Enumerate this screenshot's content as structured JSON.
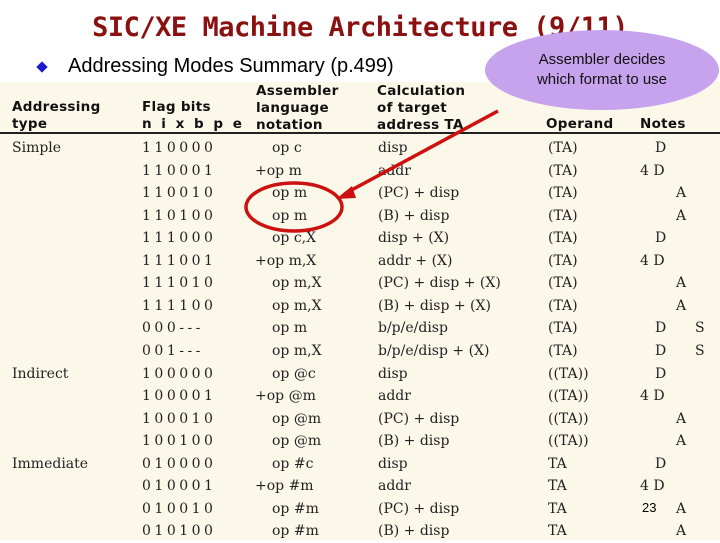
{
  "slide": {
    "title": "SIC/XE Machine Architecture (9/11)",
    "bullet": "Addressing Modes Summary (p.499)",
    "callout_line1": "Assembler decides",
    "callout_line2": "which format to use",
    "page_number": "23",
    "colors": {
      "title": "#8b1010",
      "bullet": "#1a1acc",
      "callout": "#c7a3ee",
      "annotation": "#cc1111"
    }
  },
  "table": {
    "headers": {
      "type": [
        "Addressing",
        "type"
      ],
      "flags": [
        "Flag bits",
        "n i x b p e"
      ],
      "notation": [
        "Assembler",
        "language",
        "notation"
      ],
      "calc": [
        "Calculation",
        "of target",
        "address TA"
      ],
      "operand": [
        "Operand"
      ],
      "notes": [
        "Notes"
      ]
    },
    "rows": [
      {
        "type": "Simple",
        "flags": "110000",
        "notation": "op c",
        "calc": "disp",
        "operand": "(TA)",
        "notes1": "D",
        "notes2": ""
      },
      {
        "type": "",
        "flags": "110001",
        "notation": "+op m",
        "calc": "addr",
        "operand": "(TA)",
        "notes1": "4 D",
        "notes2": ""
      },
      {
        "type": "",
        "flags": "110010",
        "notation": "op m",
        "calc": "(PC) + disp",
        "operand": "(TA)",
        "notes1": "A",
        "notes2": ""
      },
      {
        "type": "",
        "flags": "110100",
        "notation": "op m",
        "calc": "(B) + disp",
        "operand": "(TA)",
        "notes1": "A",
        "notes2": ""
      },
      {
        "type": "",
        "flags": "111000",
        "notation": "op c,X",
        "calc": "disp + (X)",
        "operand": "(TA)",
        "notes1": "D",
        "notes2": ""
      },
      {
        "type": "",
        "flags": "111001",
        "notation": "+op m,X",
        "calc": "addr + (X)",
        "operand": "(TA)",
        "notes1": "4 D",
        "notes2": ""
      },
      {
        "type": "",
        "flags": "111010",
        "notation": "op m,X",
        "calc": "(PC) + disp + (X)",
        "operand": "(TA)",
        "notes1": "A",
        "notes2": ""
      },
      {
        "type": "",
        "flags": "111100",
        "notation": "op m,X",
        "calc": "(B) + disp + (X)",
        "operand": "(TA)",
        "notes1": "A",
        "notes2": ""
      },
      {
        "type": "",
        "flags": "000---",
        "notation": "op m",
        "calc": "b/p/e/disp",
        "operand": "(TA)",
        "notes1": "D",
        "notes2": "S"
      },
      {
        "type": "",
        "flags": "001---",
        "notation": "op m,X",
        "calc": "b/p/e/disp + (X)",
        "operand": "(TA)",
        "notes1": "D",
        "notes2": "S"
      },
      {
        "type": "Indirect",
        "flags": "100000",
        "notation": "op @c",
        "calc": "disp",
        "operand": "((TA))",
        "notes1": "D",
        "notes2": ""
      },
      {
        "type": "",
        "flags": "100001",
        "notation": "+op @m",
        "calc": "addr",
        "operand": "((TA))",
        "notes1": "4 D",
        "notes2": ""
      },
      {
        "type": "",
        "flags": "100010",
        "notation": "op @m",
        "calc": "(PC) + disp",
        "operand": "((TA))",
        "notes1": "A",
        "notes2": ""
      },
      {
        "type": "",
        "flags": "100100",
        "notation": "op @m",
        "calc": "(B) + disp",
        "operand": "((TA))",
        "notes1": "A",
        "notes2": ""
      },
      {
        "type": "Immediate",
        "flags": "010000",
        "notation": "op #c",
        "calc": "disp",
        "operand": "TA",
        "notes1": "D",
        "notes2": ""
      },
      {
        "type": "",
        "flags": "010001",
        "notation": "+op #m",
        "calc": "addr",
        "operand": "TA",
        "notes1": "4 D",
        "notes2": ""
      },
      {
        "type": "",
        "flags": "010010",
        "notation": "op #m",
        "calc": "(PC) + disp",
        "operand": "TA",
        "notes1": "A",
        "notes2": ""
      },
      {
        "type": "",
        "flags": "010100",
        "notation": "op #m",
        "calc": "(B) + disp",
        "operand": "TA",
        "notes1": "A",
        "notes2": ""
      }
    ]
  }
}
